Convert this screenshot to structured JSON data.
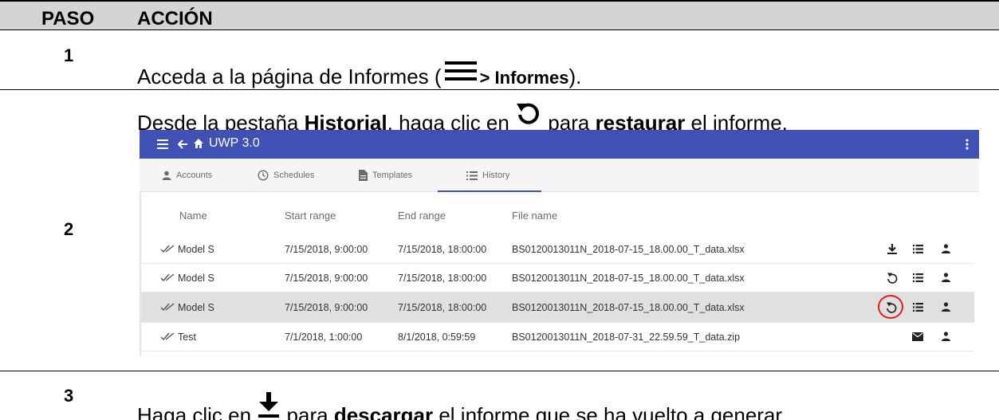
{
  "header": {
    "step_label": "PASO",
    "action_label": "ACCIÓN"
  },
  "steps": [
    {
      "number": "1",
      "text_before": "Acceda a la página de Informes (",
      "bold": "> Informes",
      "text_after": ")."
    },
    {
      "number": "2",
      "text_before": "Desde la pestaña ",
      "bold1": "Historial",
      "text_mid": ", haga clic en ",
      "text_mid2": " para ",
      "bold2": "restaurar",
      "text_after": " el informe."
    },
    {
      "number": "3",
      "text_before": "Haga clic en ",
      "text_mid": " para ",
      "bold": "descargar",
      "text_after": " el informe que se ha vuelto a generar."
    }
  ],
  "app": {
    "title": "UWP 3.0",
    "tabs": [
      {
        "label": "Accounts",
        "icon": "person-icon"
      },
      {
        "label": "Schedules",
        "icon": "clock-icon"
      },
      {
        "label": "Templates",
        "icon": "file-icon"
      },
      {
        "label": "History",
        "icon": "list-icon",
        "active": true
      }
    ],
    "columns": [
      "Name",
      "Start range",
      "End range",
      "File name"
    ],
    "rows": [
      {
        "name": "Model S",
        "start": "7/15/2018, 9:00:00",
        "end": "7/15/2018, 18:00:00",
        "file": "BS0120013011N_2018-07-15_18.00.00_T_data.xlsx",
        "action": "download"
      },
      {
        "name": "Model S",
        "start": "7/15/2018, 9:00:00",
        "end": "7/15/2018, 18:00:00",
        "file": "BS0120013011N_2018-07-15_18.00.00_T_data.xlsx",
        "action": "restore"
      },
      {
        "name": "Model S",
        "start": "7/15/2018, 9:00:00",
        "end": "7/15/2018, 18:00:00",
        "file": "BS0120013011N_2018-07-15_18.00.00_T_data.xlsx",
        "action": "restore",
        "selected": true
      },
      {
        "name": "Test",
        "start": "7/1/2018, 1:00:00",
        "end": "8/1/2018, 0:59:59",
        "file": "BS0120013011N_2018-07-31_22.59.59_T_data.zip",
        "action": "mail"
      }
    ],
    "colors": {
      "app_bar": "#3f51b5",
      "selected_row": "#e0e0e0",
      "highlight_ring": "#e02020"
    }
  }
}
